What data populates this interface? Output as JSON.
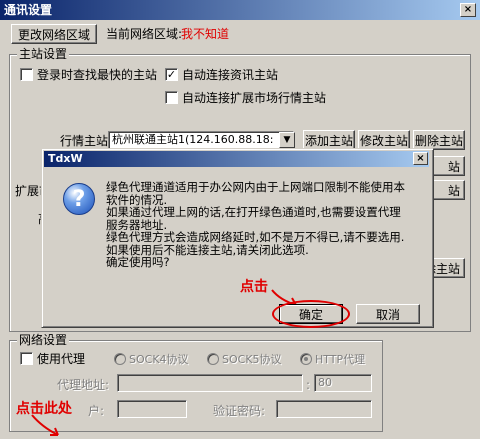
{
  "window": {
    "title": "通讯设置",
    "close_glyph": "×"
  },
  "top": {
    "change_region_button": "更改网络区域",
    "current_region_label": "当前网络区域:",
    "current_region_value": "我不知道",
    "current_region_color": "#e00000"
  },
  "master_group": {
    "legend": "主站设置",
    "find_fastest": {
      "label": "登录时查找最快的主站",
      "checked": false
    },
    "auto_connect_info": {
      "label": "自动连接资讯主站",
      "checked": true
    },
    "auto_connect_ext": {
      "label": "自动连接扩展市场行情主站",
      "checked": false
    },
    "quote_label": "行情主站:",
    "quote_value": "杭州联通主站1(124.160.88.18:",
    "ext_label": "扩展市",
    "high_label": "高",
    "add_button": "添加主站",
    "modify_button": "修改主站",
    "delete_button": "删除主站",
    "partial_button_1": "站",
    "partial_button_2": "站",
    "partial_button_3": "除主站"
  },
  "network_group": {
    "legend": "网络设置",
    "use_proxy": {
      "label": "使用代理",
      "checked": false
    },
    "radios": [
      {
        "label": "SOCK4协议",
        "selected": false
      },
      {
        "label": "SOCK5协议",
        "selected": false
      },
      {
        "label": "HTTP代理",
        "selected": true
      }
    ],
    "proxy_address_label": "代理地址:",
    "port_value": "80",
    "user_label_partial": "户:",
    "password_label": "验证密码:",
    "colon": ":"
  },
  "dialog": {
    "title": "TdxW",
    "close_glyph": "×",
    "icon_glyph": "?",
    "message": [
      "绿色代理通道适用于办公网内由于上网端口限制不能使用本",
      "软件的情况.",
      "如果通过代理上网的话,在打开绿色通道时,也需要设置代理",
      "服务器地址.",
      "绿色代理方式会造成网络延时,如不是万不得已,请不要选用.",
      "如果使用后不能连接主站,请关闭此选项.",
      "确定使用吗?"
    ],
    "ok_button": "确定",
    "cancel_button": "取消"
  },
  "annotations": {
    "click_label": "点击",
    "click_here_label": "点击此处",
    "color": "#e00000"
  }
}
